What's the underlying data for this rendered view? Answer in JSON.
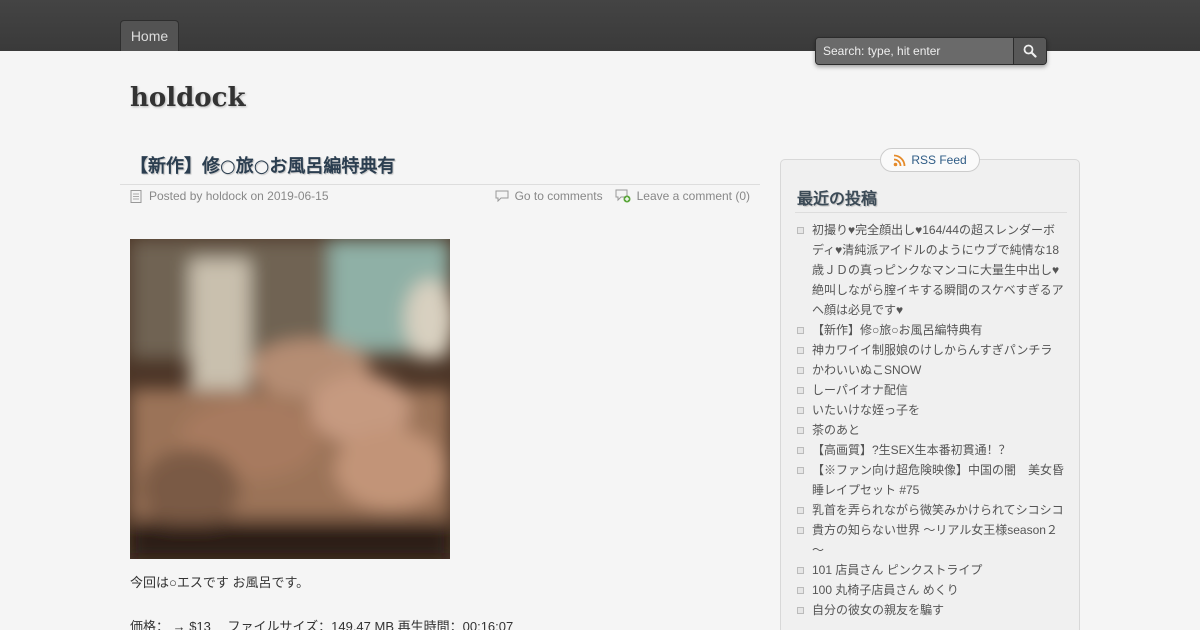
{
  "nav": {
    "home_label": "Home"
  },
  "search": {
    "placeholder": "Search: type, hit enter"
  },
  "site": {
    "title": "holdock"
  },
  "post": {
    "title": "【新作】修○旅○お風呂編特典有",
    "posted_by_prefix": "Posted by",
    "author": "holdock",
    "on": "on",
    "date": "2019-06-15",
    "go_to_comments": "Go to comments",
    "leave_comment": "Leave a comment (0)",
    "body_text": "今回は○エスです お風呂です。",
    "info_text": "価格： → $13　 ファイルサイズ：149.47 MB 再生時間：00:16:07"
  },
  "sidebar": {
    "rss_label": "RSS Feed",
    "widget_title": "最近の投稿",
    "recent_posts": [
      "初撮り♥完全顔出し♥164/44の超スレンダーボディ♥清純派アイドルのようにウブで純情な18歳ＪＤの真っピンクなマンコに大量生中出し♥絶叫しながら膣イキする瞬間のスケベすぎるアヘ顔は必見です♥",
      "【新作】修○旅○お風呂編特典有",
      "神カワイイ制服娘のけしからんすぎパンチラ",
      "かわいいぬこSNOW",
      "しーパイオナ配信",
      "いたいけな姪っ子を",
      "茶のあと",
      "【高画質】?生SEX生本番初貫通！？",
      "【※ファン向け超危険映像】中国の闇　美女昏睡レイプセット #75",
      "乳首を弄られながら微笑みかけられてシコシコ",
      "貴方の知らない世界 ～リアル女王様season２～",
      "101 店員さん ピンクストライプ",
      "100 丸椅子店員さん めくり",
      "自分の彼女の親友を騙す"
    ]
  },
  "colors": {
    "topbar": "#3f3f3f",
    "link": "#2f5c86"
  }
}
